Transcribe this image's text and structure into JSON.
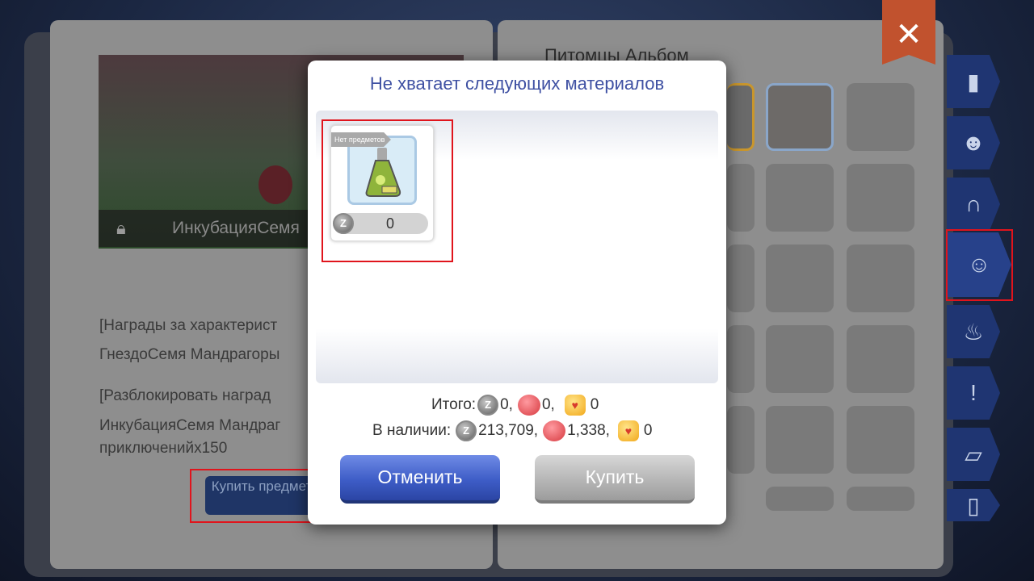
{
  "background": {
    "left_page": {
      "preview_label": "ИнкубацияСемя",
      "lines": [
        "[Награды за характерист",
        "ГнездоСемя Мандрагоры",
        "[Разблокировать наград",
        "ИнкубацияСемя Мандраг",
        "приключенийх150"
      ],
      "buy_item_button": "Купить предмет"
    },
    "right_page": {
      "title": "Питомцы Альбом"
    },
    "close_glyph": "✕"
  },
  "dialog": {
    "title": "Не хватает следующих материалов",
    "item": {
      "badge": "Нет предметов",
      "price": "0"
    },
    "total": {
      "label": "Итого:",
      "zeny": "0,",
      "ruby": "0,",
      "cat_coin": "0"
    },
    "available": {
      "label": "В наличии:",
      "zeny": "213,709,",
      "ruby": "1,338,",
      "cat_coin": "0"
    },
    "cancel_label": "Отменить",
    "buy_label": "Купить"
  },
  "icons": {
    "zeny_coin": "Z",
    "cat_coin": "♥"
  },
  "colors": {
    "highlight_red": "#e0141c",
    "title_blue": "#3f51a3",
    "cancel_blue": "#3e5dc7",
    "buy_gray": "#b3b3b3"
  }
}
